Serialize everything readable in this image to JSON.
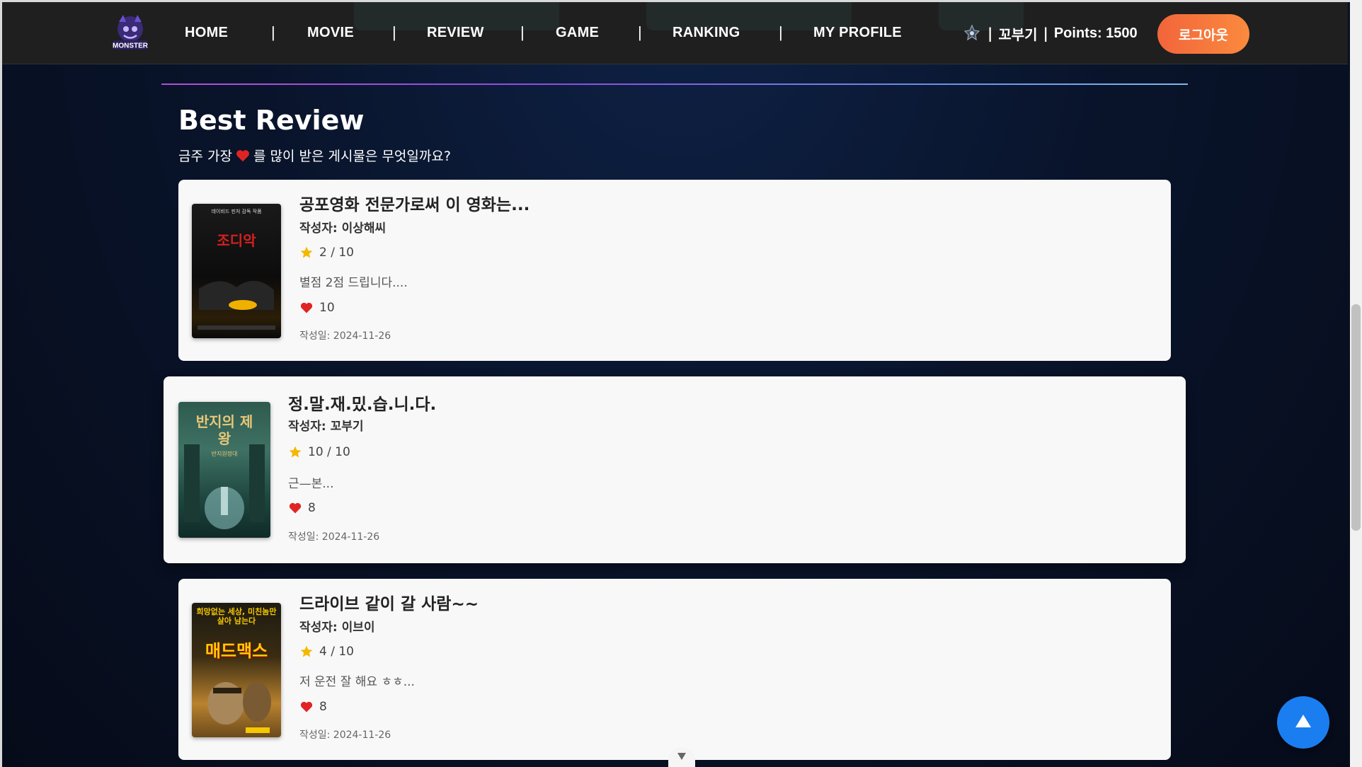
{
  "nav": {
    "items": [
      {
        "label": "HOME"
      },
      {
        "label": "MOVIE"
      },
      {
        "label": "REVIEW"
      },
      {
        "label": "GAME"
      },
      {
        "label": "RANKING"
      },
      {
        "label": "MY PROFILE"
      }
    ],
    "separator": "|",
    "user_sep": "|",
    "username": "꼬부기",
    "points": "Points: 1500",
    "logout_label": "로그아웃",
    "logo_text": "MONSTER"
  },
  "section": {
    "title": "Best Review",
    "subtitle_before": "금주 가장",
    "subtitle_after": "를 많이 받은 게시물은 무엇일까요?"
  },
  "reviews": [
    {
      "title": "공포영화 전문가로써 이 영화는...",
      "author": "작성자: 이상해씨",
      "rating": "2 / 10",
      "body": "별점 2점 드립니다....",
      "likes": "10",
      "date": "작성일: 2024-11-26",
      "poster_title": "조디악",
      "poster_caption": "데이비드 핀처 감독 작품"
    },
    {
      "title": "정.말.재.밌.습.니.다.",
      "author": "작성자: 꼬부기",
      "rating": "10 / 10",
      "body": "근—본...",
      "likes": "8",
      "date": "작성일: 2024-11-26",
      "poster_title": "반지의 제왕",
      "poster_caption": "반지원정대"
    },
    {
      "title": "드라이브 같이 갈 사람~~",
      "author": "작성자: 이브이",
      "rating": "4 / 10",
      "body": "저 운전 잘 해요 ㅎㅎ...",
      "likes": "8",
      "date": "작성일: 2024-11-26",
      "poster_title": "매드맥스",
      "poster_caption": "희망없는 세상, 미친놈만 살아 남는다"
    }
  ],
  "colors": {
    "accent_orange": "#f2653b",
    "to_top_blue": "#1a7ef0",
    "heart_red": "#e02424",
    "star_yellow": "#f5b800"
  },
  "icons": [
    "monster-logo-icon",
    "user-badge-icon",
    "star-icon",
    "heart-icon",
    "arrow-up-icon",
    "chevron-down-icon"
  ]
}
